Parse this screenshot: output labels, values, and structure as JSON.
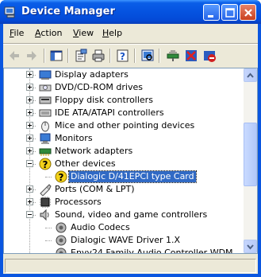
{
  "window": {
    "title": "Device Manager"
  },
  "menu": [
    {
      "pre": "",
      "key": "F",
      "post": "ile"
    },
    {
      "pre": "",
      "key": "A",
      "post": "ction"
    },
    {
      "pre": "",
      "key": "V",
      "post": "iew"
    },
    {
      "pre": "",
      "key": "H",
      "post": "elp"
    }
  ],
  "toolbar": [
    "back-icon",
    "forward-icon",
    "console-tree-icon",
    "properties-icon",
    "print-icon",
    "help-icon",
    "scan-hardware-icon",
    "update-driver-icon",
    "uninstall-icon",
    "disable-icon"
  ],
  "tree": [
    {
      "label": "Display adapters",
      "level": 0,
      "expander": "plus",
      "icon": "display-adapter-icon"
    },
    {
      "label": "DVD/CD-ROM drives",
      "level": 0,
      "expander": "plus",
      "icon": "cdrom-icon"
    },
    {
      "label": "Floppy disk controllers",
      "level": 0,
      "expander": "plus",
      "icon": "floppy-controller-icon"
    },
    {
      "label": "IDE ATA/ATAPI controllers",
      "level": 0,
      "expander": "plus",
      "icon": "ide-controller-icon"
    },
    {
      "label": "Mice and other pointing devices",
      "level": 0,
      "expander": "plus",
      "icon": "mouse-icon"
    },
    {
      "label": "Monitors",
      "level": 0,
      "expander": "plus",
      "icon": "monitor-icon"
    },
    {
      "label": "Network adapters",
      "level": 0,
      "expander": "plus",
      "icon": "network-adapter-icon"
    },
    {
      "label": "Other devices",
      "level": 0,
      "expander": "minus",
      "icon": "unknown-device-icon"
    },
    {
      "label": "Dialogic D/41EPCI type Card",
      "level": 1,
      "expander": "",
      "icon": "unknown-device-icon",
      "selected": true
    },
    {
      "label": "Ports (COM & LPT)",
      "level": 0,
      "expander": "plus",
      "icon": "port-icon"
    },
    {
      "label": "Processors",
      "level": 0,
      "expander": "plus",
      "icon": "processor-icon"
    },
    {
      "label": "Sound, video and game controllers",
      "level": 0,
      "expander": "minus",
      "icon": "sound-icon"
    },
    {
      "label": "Audio Codecs",
      "level": 1,
      "expander": "",
      "icon": "audio-device-icon"
    },
    {
      "label": "Dialogic WAVE Driver 1.X",
      "level": 1,
      "expander": "",
      "icon": "audio-device-icon"
    },
    {
      "label": "Envy24 Family Audio Controller WDM",
      "level": 1,
      "expander": "",
      "icon": "audio-device-icon"
    }
  ]
}
